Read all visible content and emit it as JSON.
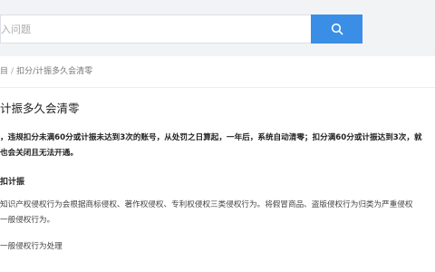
{
  "search": {
    "placeholder": "入问题"
  },
  "breadcrumb": {
    "root": "目",
    "separator": "/",
    "current": "扣分/计振多久会清零"
  },
  "article": {
    "title": "计振多久会清零",
    "bold_lines": [
      "，违规扣分未满60分或计振未达到3次的账号，从处罚之日算起，一年后，系统自动清零；扣分满60分或计振达到3次，就",
      "也会关闭且无法开通。"
    ],
    "section_heading": "扣计振",
    "para_lines": [
      "知识产权侵权行为会根据商标侵权、著作权侵权、专利权侵权三类侵权行为。将假冒商品、盗版侵权行为归类为严重侵权",
      "一般侵权行为。"
    ],
    "sub_heading": "一般侵权行为处理"
  },
  "colors": {
    "accent": "#3a8ee6",
    "background": "#f2f3f5"
  },
  "icons": {
    "search_button": "search-icon"
  }
}
